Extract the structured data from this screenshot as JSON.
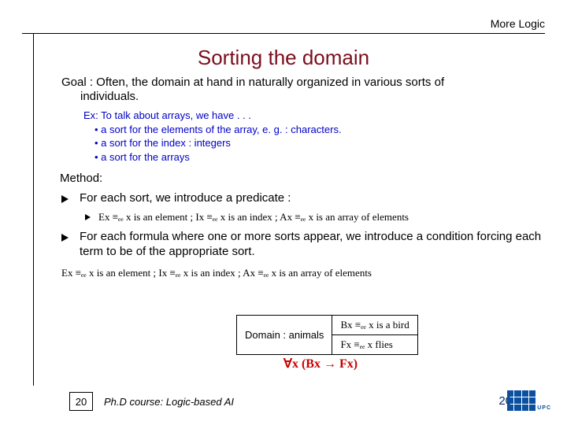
{
  "header": {
    "label": "More Logic"
  },
  "title": "Sorting the domain",
  "goal": {
    "line1": "Goal :  Often, the domain at hand in naturally organized in various sorts of",
    "line2": "individuals."
  },
  "example": {
    "intro": "Ex: To talk about arrays, we have . . .",
    "items": [
      "a sort for the elements of the array, e. g. : characters.",
      "a sort for the index : integers",
      "a sort for the arrays"
    ]
  },
  "method": {
    "label": "Method:",
    "point1": "For each sort, we introduce a predicate :",
    "sub1": "Ex ≡ₑₑ x is an element  ;  Ix ≡ₑₑ x is an index ; Ax ≡ₑₑ x is an array of elements",
    "point2": "For each formula where one or more sorts appear, we introduce a  condition forcing  each term to be of the appropriate sort."
  },
  "defline": "Ex ≡ₑₑ x is an element  ;  Ix ≡ₑₑ x is an index ; Ax ≡ₑₑ x is an array of elements",
  "table": {
    "r1c1": "Domain : animals",
    "r1c2": "Bx ≡ₑₑ x is a bird",
    "r2c2": "Fx ≡ₑₑ x flies"
  },
  "redline": "∀x (Bx → Fx)",
  "footer": {
    "pagebox": "20",
    "course": "Ph.D course: Logic-based AI",
    "pagenum": "20",
    "logo_text": "UPC"
  }
}
